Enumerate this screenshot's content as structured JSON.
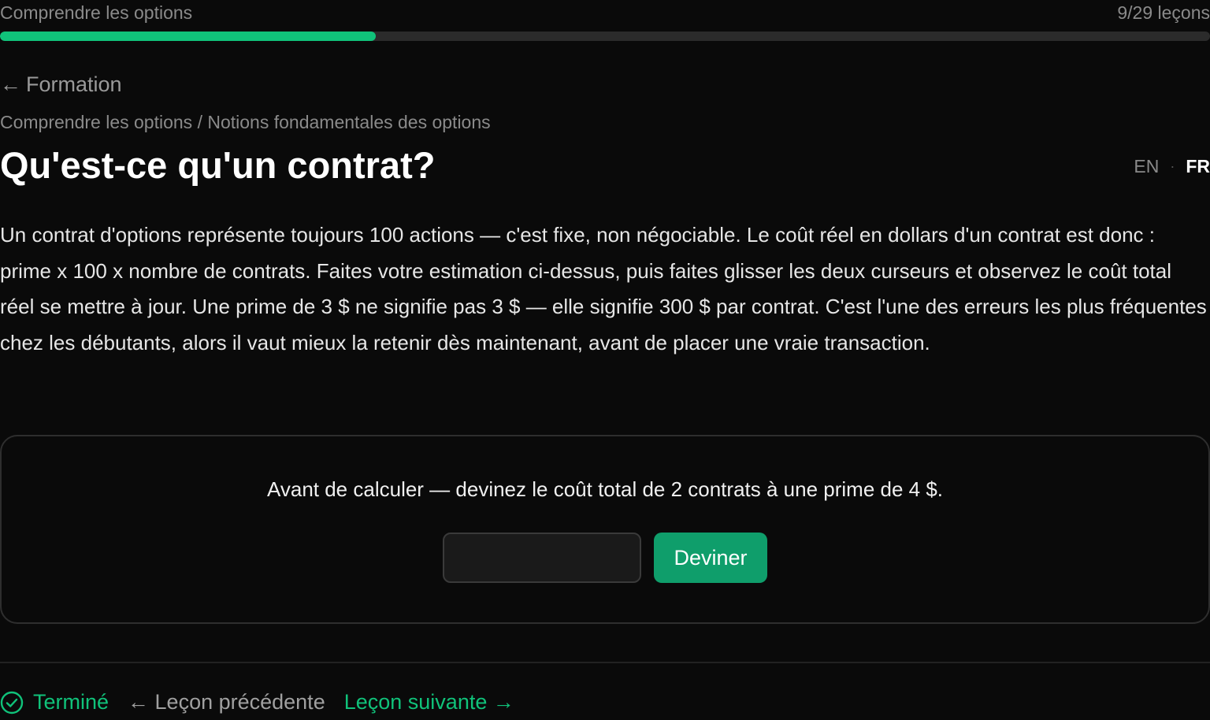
{
  "header": {
    "course_title": "Comprendre les options",
    "lesson_count": "9/29 leçons",
    "progress_fraction": 0.3103
  },
  "nav": {
    "back_arrow": "←",
    "back_label": "Formation",
    "breadcrumb": "Comprendre les options / Notions fondamentales des options"
  },
  "lesson": {
    "title": "Qu'est-ce qu'un contrat?",
    "body": "Un contrat d'options représente toujours 100 actions — c'est fixe, non négociable. Le coût réel en dollars d'un contrat est donc : prime x 100 x nombre de contrats. Faites votre estimation ci-dessus, puis faites glisser les deux curseurs et observez le coût total réel se mettre à jour. Une prime de 3 $ ne signifie pas 3 $ — elle signifie 300 $ par contrat. C'est l'une des erreurs les plus fréquentes chez les débutants, alors il vaut mieux la retenir dès maintenant, avant de placer une vraie transaction."
  },
  "language": {
    "en": "EN",
    "separator": "·",
    "fr": "FR",
    "active": "FR"
  },
  "quiz": {
    "question": "Avant de calculer — devinez le coût total de 2 contrats à une prime de 4 $.",
    "input_value": "",
    "button_label": "Deviner"
  },
  "footer": {
    "done_label": "Terminé",
    "prev_label": "← Leçon précédente",
    "next_label": "Leçon suivante →"
  },
  "colors": {
    "accent": "#10c27a",
    "button": "#0f9e6b",
    "background": "#0a0a0a"
  },
  "icons": {
    "done": "check-circle-icon",
    "back": "arrow-left-icon"
  }
}
